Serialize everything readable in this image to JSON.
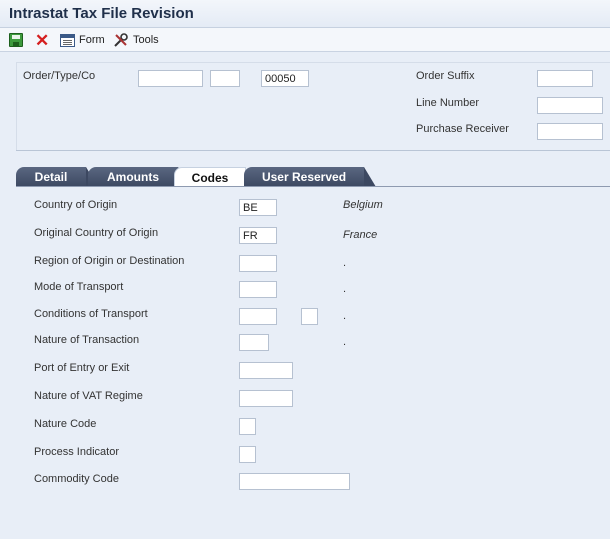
{
  "window": {
    "title": "Intrastat Tax File Revision"
  },
  "toolbar": {
    "save_icon": "save-icon",
    "cancel_icon": "close-icon",
    "form_label": "Form",
    "tools_label": "Tools"
  },
  "header": {
    "order_type_co_label": "Order/Type/Co",
    "order_number_value": "",
    "order_type_value": "",
    "company_value": "00050",
    "order_suffix_label": "Order Suffix",
    "order_suffix_value": "",
    "line_number_label": "Line Number",
    "line_number_value": "",
    "purchase_receiver_label": "Purchase Receiver",
    "purchase_receiver_value": ""
  },
  "tabs": [
    {
      "label": "Detail"
    },
    {
      "label": "Amounts"
    },
    {
      "label": "Codes"
    },
    {
      "label": "User Reserved"
    }
  ],
  "active_tab": "Codes",
  "codes": {
    "country_of_origin_label": "Country of Origin",
    "country_of_origin_value": "BE",
    "country_of_origin_desc": "Belgium",
    "original_country_label": "Original Country of Origin",
    "original_country_value": "FR",
    "original_country_desc": "France",
    "region_label": "Region of Origin or Destination",
    "region_value": "",
    "region_desc": ".",
    "mode_transport_label": "Mode of Transport",
    "mode_transport_value": "",
    "mode_transport_desc": ".",
    "conditions_transport_label": "Conditions of Transport",
    "conditions_transport_value": "",
    "conditions_transport_value2": "",
    "conditions_transport_desc": ".",
    "nature_transaction_label": "Nature of Transaction",
    "nature_transaction_value": "",
    "nature_transaction_desc": ".",
    "port_label": "Port of Entry or Exit",
    "port_value": "",
    "vat_regime_label": "Nature of VAT Regime",
    "vat_regime_value": "",
    "nature_code_label": "Nature Code",
    "nature_code_value": "",
    "process_indicator_label": "Process Indicator",
    "process_indicator_value": "",
    "commodity_code_label": "Commodity Code",
    "commodity_code_value": ""
  },
  "colors": {
    "background": "#e8eef7",
    "tab_dark": "#3c4861",
    "title_text": "#1f2f4a",
    "cancel_red": "#d51f1f",
    "save_green": "#3d9a3d"
  }
}
